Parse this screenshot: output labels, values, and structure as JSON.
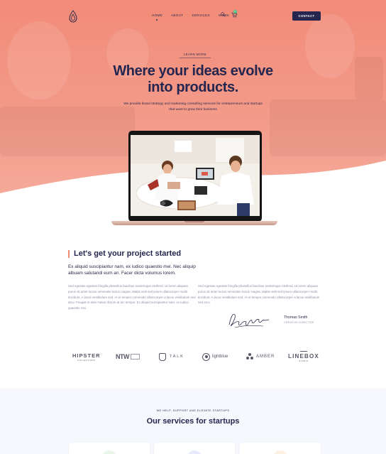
{
  "brand": {
    "logo_icon": "drop-logo-icon"
  },
  "nav": {
    "items": [
      {
        "label": "HOME",
        "active": true
      },
      {
        "label": "ABOUT",
        "active": false
      },
      {
        "label": "SERVICES",
        "active": false
      },
      {
        "label": "WORK",
        "active": false
      }
    ],
    "search_icon": "search-icon",
    "cart_icon": "cart-icon",
    "cart_count": "0",
    "contact_label": "CONTACT"
  },
  "hero": {
    "kicker": "LEARN MORE",
    "title_line1": "Where your ideas evolve",
    "title_line2": "into products.",
    "subtitle_line1": "We provide brand strategy and marketing consulting services for entrepreneurs and startups",
    "subtitle_line2": "that want to grow their business"
  },
  "project": {
    "title": "Let's get your project started",
    "lead": "Ex aliquid suscipiantur nam, ex iudico quaestio mei. Nec aliquip albuam salutandi eum an. Facer dicta volumus lorem.",
    "col1": "Sed egestas egestas fringilla phasellus faucibus scelerisque eleifend. Ut lorem aliquam purus sit amet luctus venenatis lectus magna. Mattis velit sed ipsum ullamcorper morbi tincidunt. A lacus vestibulum sed. At et tempor commodo ullamcorper a lacus vestibulum sed arcu. Feugiat in ante metus dictum at arc tempor. Ex aliquid suscipiantur nam, ex iudico quaestio mei.",
    "col2": "Sed egestas egestas fringilla phasellus faucibus scelerisque eleifend. Ut lorem aliquam purus sit amet luctus venenatis lectus magna. Mattis velit sed ipsum ullamcorper morbi tincidunt. A lacus vestibulum sed. At et tempor commodo ullamcorper a lacus vestibulum sed arcu.",
    "signer_name": "Thomas Smith",
    "signer_role": "CREATIVE DIRECTOR",
    "signature_text": "Frank Sinatra"
  },
  "logos": {
    "hipster": "HIPSTER",
    "hipster_sub": "COLLECTIONS",
    "ntw": "NTW",
    "talk": "TALK",
    "lightblue": "lightblue",
    "amber": "AMBER",
    "linebox": "LINEBOX",
    "linebox_sub": "STUDIO"
  },
  "services": {
    "kicker": "WE HELP, SUPPORT AND ELEVATE STARTUPS",
    "title": "Our services for startups"
  },
  "colors": {
    "accent": "#f28b78",
    "navy": "#25264f",
    "muted": "#8d8fa6",
    "section_bg": "#f6f8fd"
  }
}
